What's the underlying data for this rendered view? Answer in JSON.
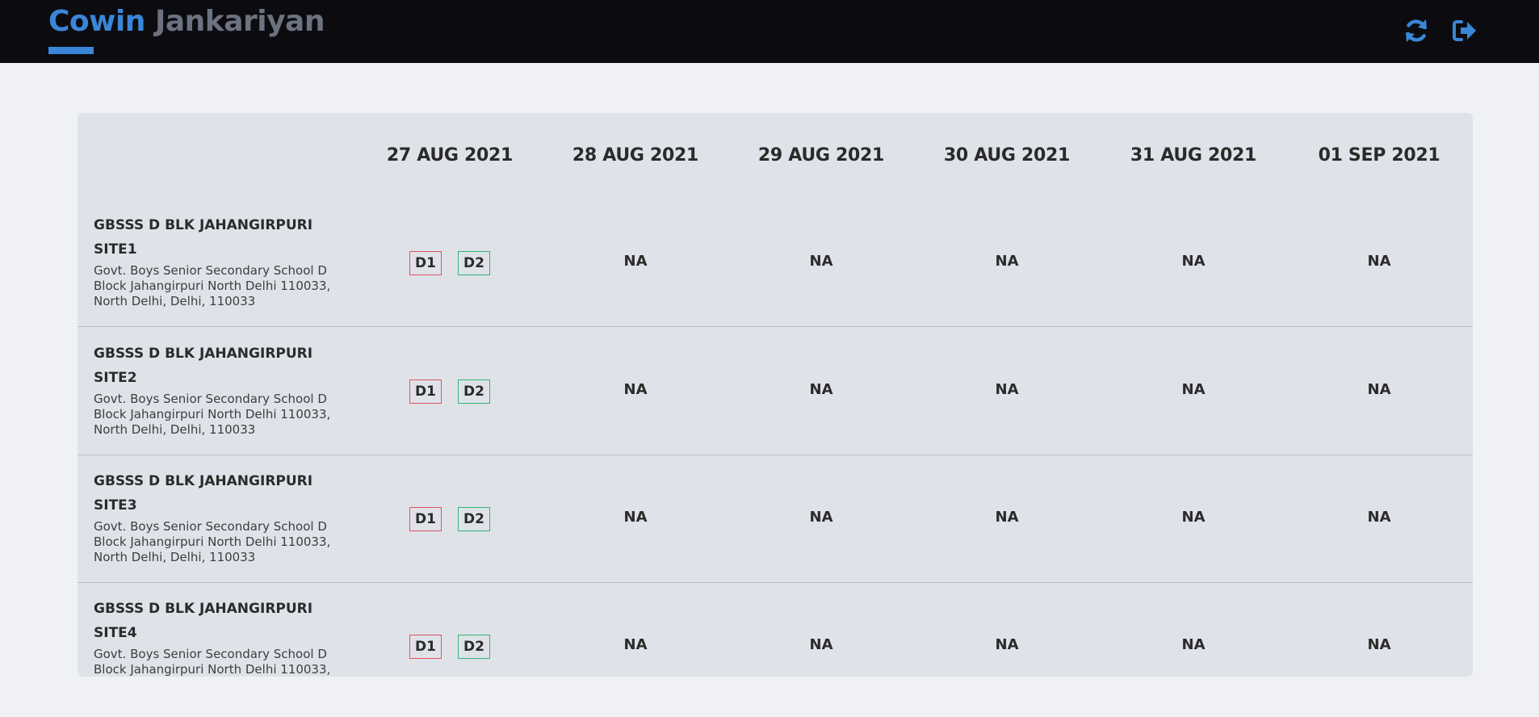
{
  "app": {
    "brand_part1": "Cowin",
    "brand_part2": "Jankariyan",
    "accent_color": "#3a86d8",
    "icons": [
      "refresh-icon",
      "logout-icon"
    ]
  },
  "dates": [
    "27 AUG 2021",
    "28 AUG 2021",
    "29 AUG 2021",
    "30 AUG 2021",
    "31 AUG 2021",
    "01 SEP 2021"
  ],
  "dose_labels": {
    "d1": "D1",
    "d2": "D2"
  },
  "centers": [
    {
      "name_line1": "GBSSS D BLK JAHANGIRPURI",
      "name_line2": "SITE1",
      "address": "Govt. Boys Senior Secondary School D Block Jahangirpuri North Delhi 110033, North Delhi, Delhi, 110033",
      "slots": [
        "D1 D2",
        "NA",
        "NA",
        "NA",
        "NA",
        "NA"
      ]
    },
    {
      "name_line1": "GBSSS D BLK JAHANGIRPURI",
      "name_line2": "SITE2",
      "address": "Govt. Boys Senior Secondary School D Block Jahangirpuri North Delhi 110033, North Delhi, Delhi, 110033",
      "slots": [
        "D1 D2",
        "NA",
        "NA",
        "NA",
        "NA",
        "NA"
      ]
    },
    {
      "name_line1": "GBSSS D BLK JAHANGIRPURI",
      "name_line2": "SITE3",
      "address": "Govt. Boys Senior Secondary School D Block Jahangirpuri North Delhi 110033, North Delhi, Delhi, 110033",
      "slots": [
        "D1 D2",
        "NA",
        "NA",
        "NA",
        "NA",
        "NA"
      ]
    },
    {
      "name_line1": "GBSSS D BLK JAHANGIRPURI",
      "name_line2": "SITE4",
      "address": "Govt. Boys Senior Secondary School D Block Jahangirpuri North Delhi 110033,",
      "slots": [
        "D1 D2",
        "NA",
        "NA",
        "NA",
        "NA",
        "NA"
      ]
    }
  ]
}
